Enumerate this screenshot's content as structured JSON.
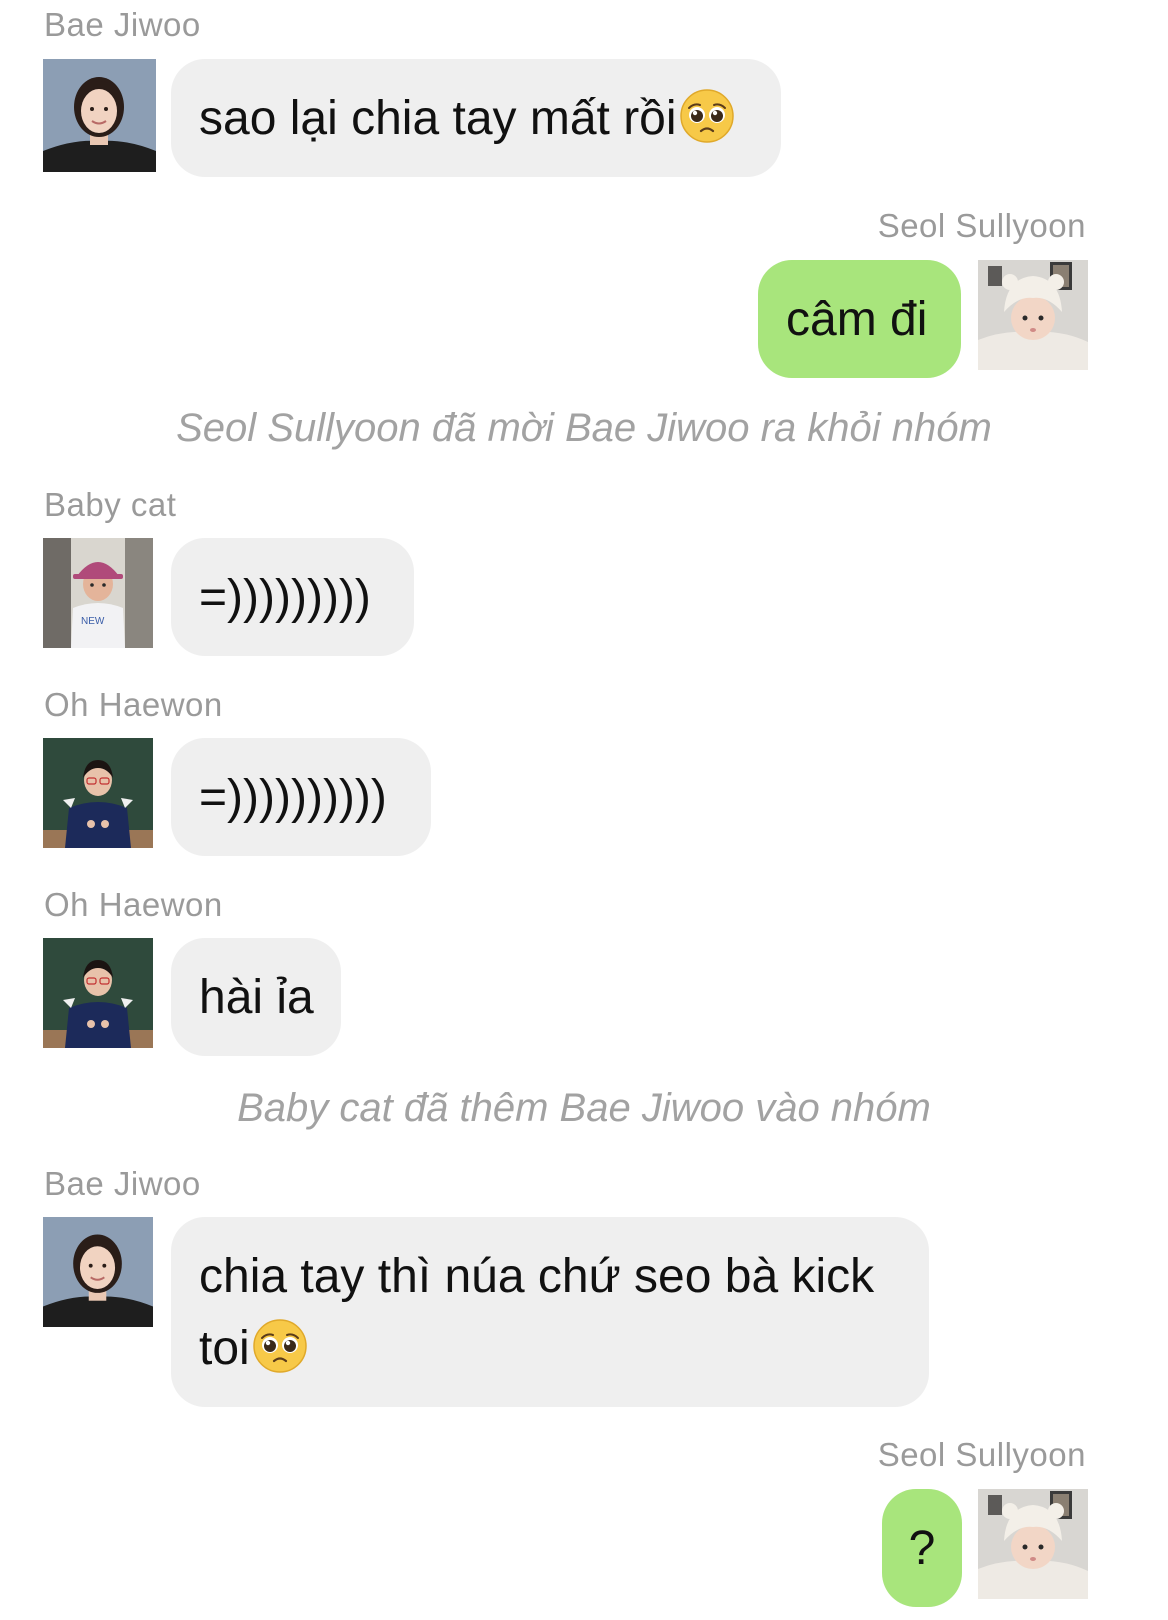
{
  "messages": [
    {
      "sender": "Bae Jiwoo",
      "text": "sao lại chia tay mất rồi",
      "emoji": "pleading-face"
    },
    {
      "sender": "Seol Sullyoon",
      "text": "câm đi"
    },
    {
      "system": "Seol Sullyoon đã mời Bae Jiwoo ra khỏi nhóm"
    },
    {
      "sender": "Baby cat",
      "text": "=)))))))))"
    },
    {
      "sender": "Oh Haewon",
      "text": "=))))))))))"
    },
    {
      "sender": "Oh Haewon",
      "text": "hài ỉa"
    },
    {
      "system": "Baby cat đã thêm Bae Jiwoo vào nhóm"
    },
    {
      "sender": "Bae Jiwoo",
      "text": "chia tay thì núa chứ seo bà kick toi",
      "emoji": "pleading-face"
    },
    {
      "sender": "Seol Sullyoon",
      "text": "?"
    }
  ],
  "colors": {
    "incoming_bubble": "#efefef",
    "outgoing_bubble": "#a8e57c",
    "sender_name": "#9a9a9a",
    "system_text": "#a2a2a2"
  },
  "avatars": {
    "bae_jiwoo": "girl-portrait-dark-hair",
    "seol_sullyoon": "baby-in-white-hat",
    "baby_cat": "child-with-pink-hat",
    "oh_haewon": "girl-with-glasses-chalkboard"
  }
}
